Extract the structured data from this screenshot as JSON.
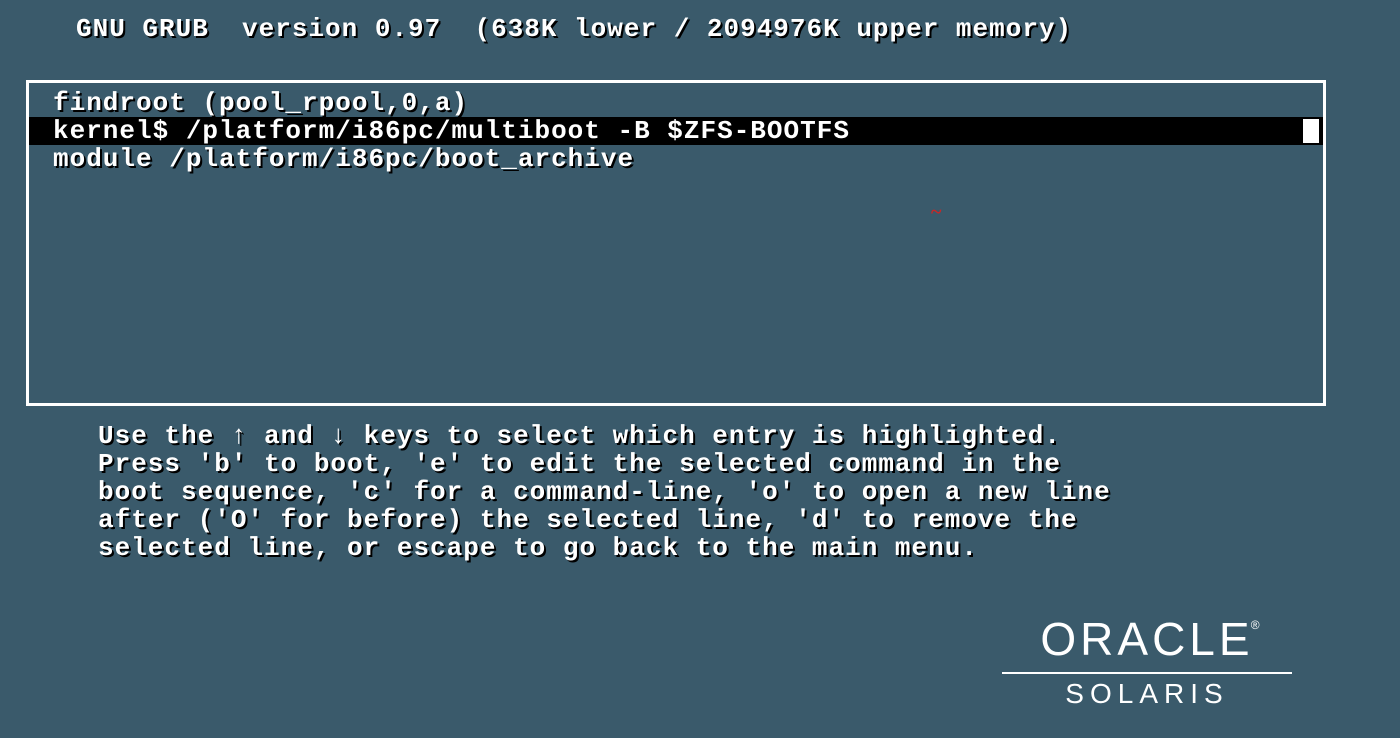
{
  "header": "GNU GRUB  version 0.97  (638K lower / 2094976K upper memory)",
  "menu": {
    "lines": [
      {
        "text": "findroot (pool_rpool,0,a)",
        "selected": false
      },
      {
        "text": "kernel$ /platform/i86pc/multiboot -B $ZFS-BOOTFS ",
        "selected": true
      },
      {
        "text": "module /platform/i86pc/boot_archive",
        "selected": false
      }
    ],
    "annotation": "~"
  },
  "help": "Use the ↑ and ↓ keys to select which entry is highlighted.\nPress 'b' to boot, 'e' to edit the selected command in the\nboot sequence, 'c' for a command-line, 'o' to open a new line\nafter ('O' for before) the selected line, 'd' to remove the\nselected line, or escape to go back to the main menu.",
  "brand": {
    "line1": "ORACLE",
    "line2": "SOLARIS"
  }
}
